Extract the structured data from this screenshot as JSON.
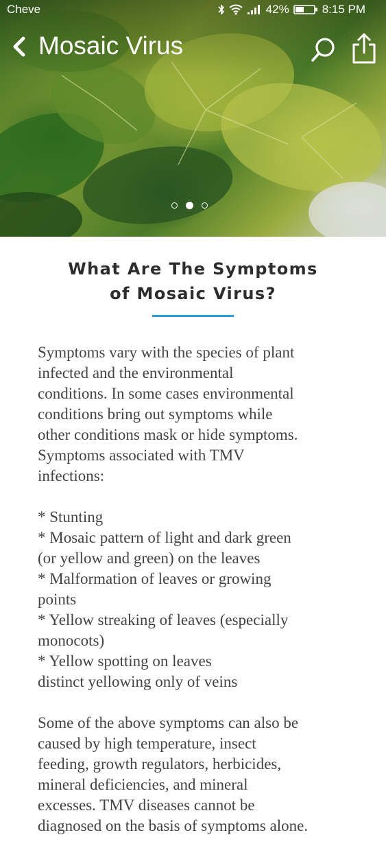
{
  "status_bar": {
    "carrier": "Cheve",
    "battery": "42%",
    "time": "8:15 PM"
  },
  "header": {
    "title": "Mosaic Virus"
  },
  "carousel": {
    "slide_count": 3,
    "active_index": 1
  },
  "article": {
    "heading_line1": "What Are The Symptoms",
    "heading_line2": "of Mosaic Virus?",
    "accent_color": "#2aa3d9",
    "paragraph1": "Symptoms vary with the species of plant\ninfected and the environmental\nconditions. In some cases environmental\nconditions bring out symptoms while\nother conditions mask or hide symptoms.\nSymptoms associated with TMV\ninfections:",
    "list": [
      "* Stunting",
      "* Mosaic pattern of light and dark green\n(or yellow and green) on the leaves",
      "* Malformation of leaves or growing\npoints",
      "* Yellow streaking of leaves (especially\nmonocots)",
      "* Yellow spotting on leaves\ndistinct yellowing only of veins"
    ],
    "paragraph2": "Some of the above symptoms can also be\ncaused by high temperature, insect\nfeeding, growth regulators, herbicides,\nmineral deficiencies, and mineral\nexcesses. TMV diseases cannot be\ndiagnosed on the basis of symptoms alone."
  }
}
